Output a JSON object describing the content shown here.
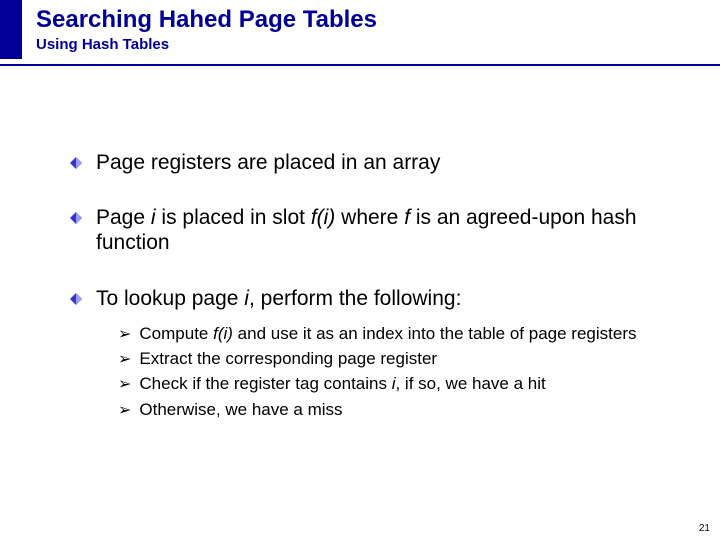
{
  "header": {
    "title": "Searching Hahed Page Tables",
    "subtitle": "Using Hash Tables"
  },
  "bullets": {
    "b1": "Page registers are placed in an array",
    "b2_pre": "Page ",
    "b2_i1": "i",
    "b2_mid1": " is placed in slot ",
    "b2_i2": "f(i)",
    "b2_mid2": " where ",
    "b2_i3": "f",
    "b2_post": " is an agreed-upon hash function",
    "b3_pre": "To lookup page ",
    "b3_i1": "i",
    "b3_post": ", perform the following:"
  },
  "subs": {
    "s1_pre": "Compute ",
    "s1_i1": "f(i)",
    "s1_post": " and use it as an index into the table of page registers",
    "s2": "Extract the corresponding page register",
    "s3_pre": "Check if the register tag contains ",
    "s3_i1": "i",
    "s3_post": ", if so, we have a hit",
    "s4": "Otherwise, we have a miss"
  },
  "glyphs": {
    "chevron": "➢"
  },
  "page_number": "21",
  "colors": {
    "brand": "#000099"
  }
}
